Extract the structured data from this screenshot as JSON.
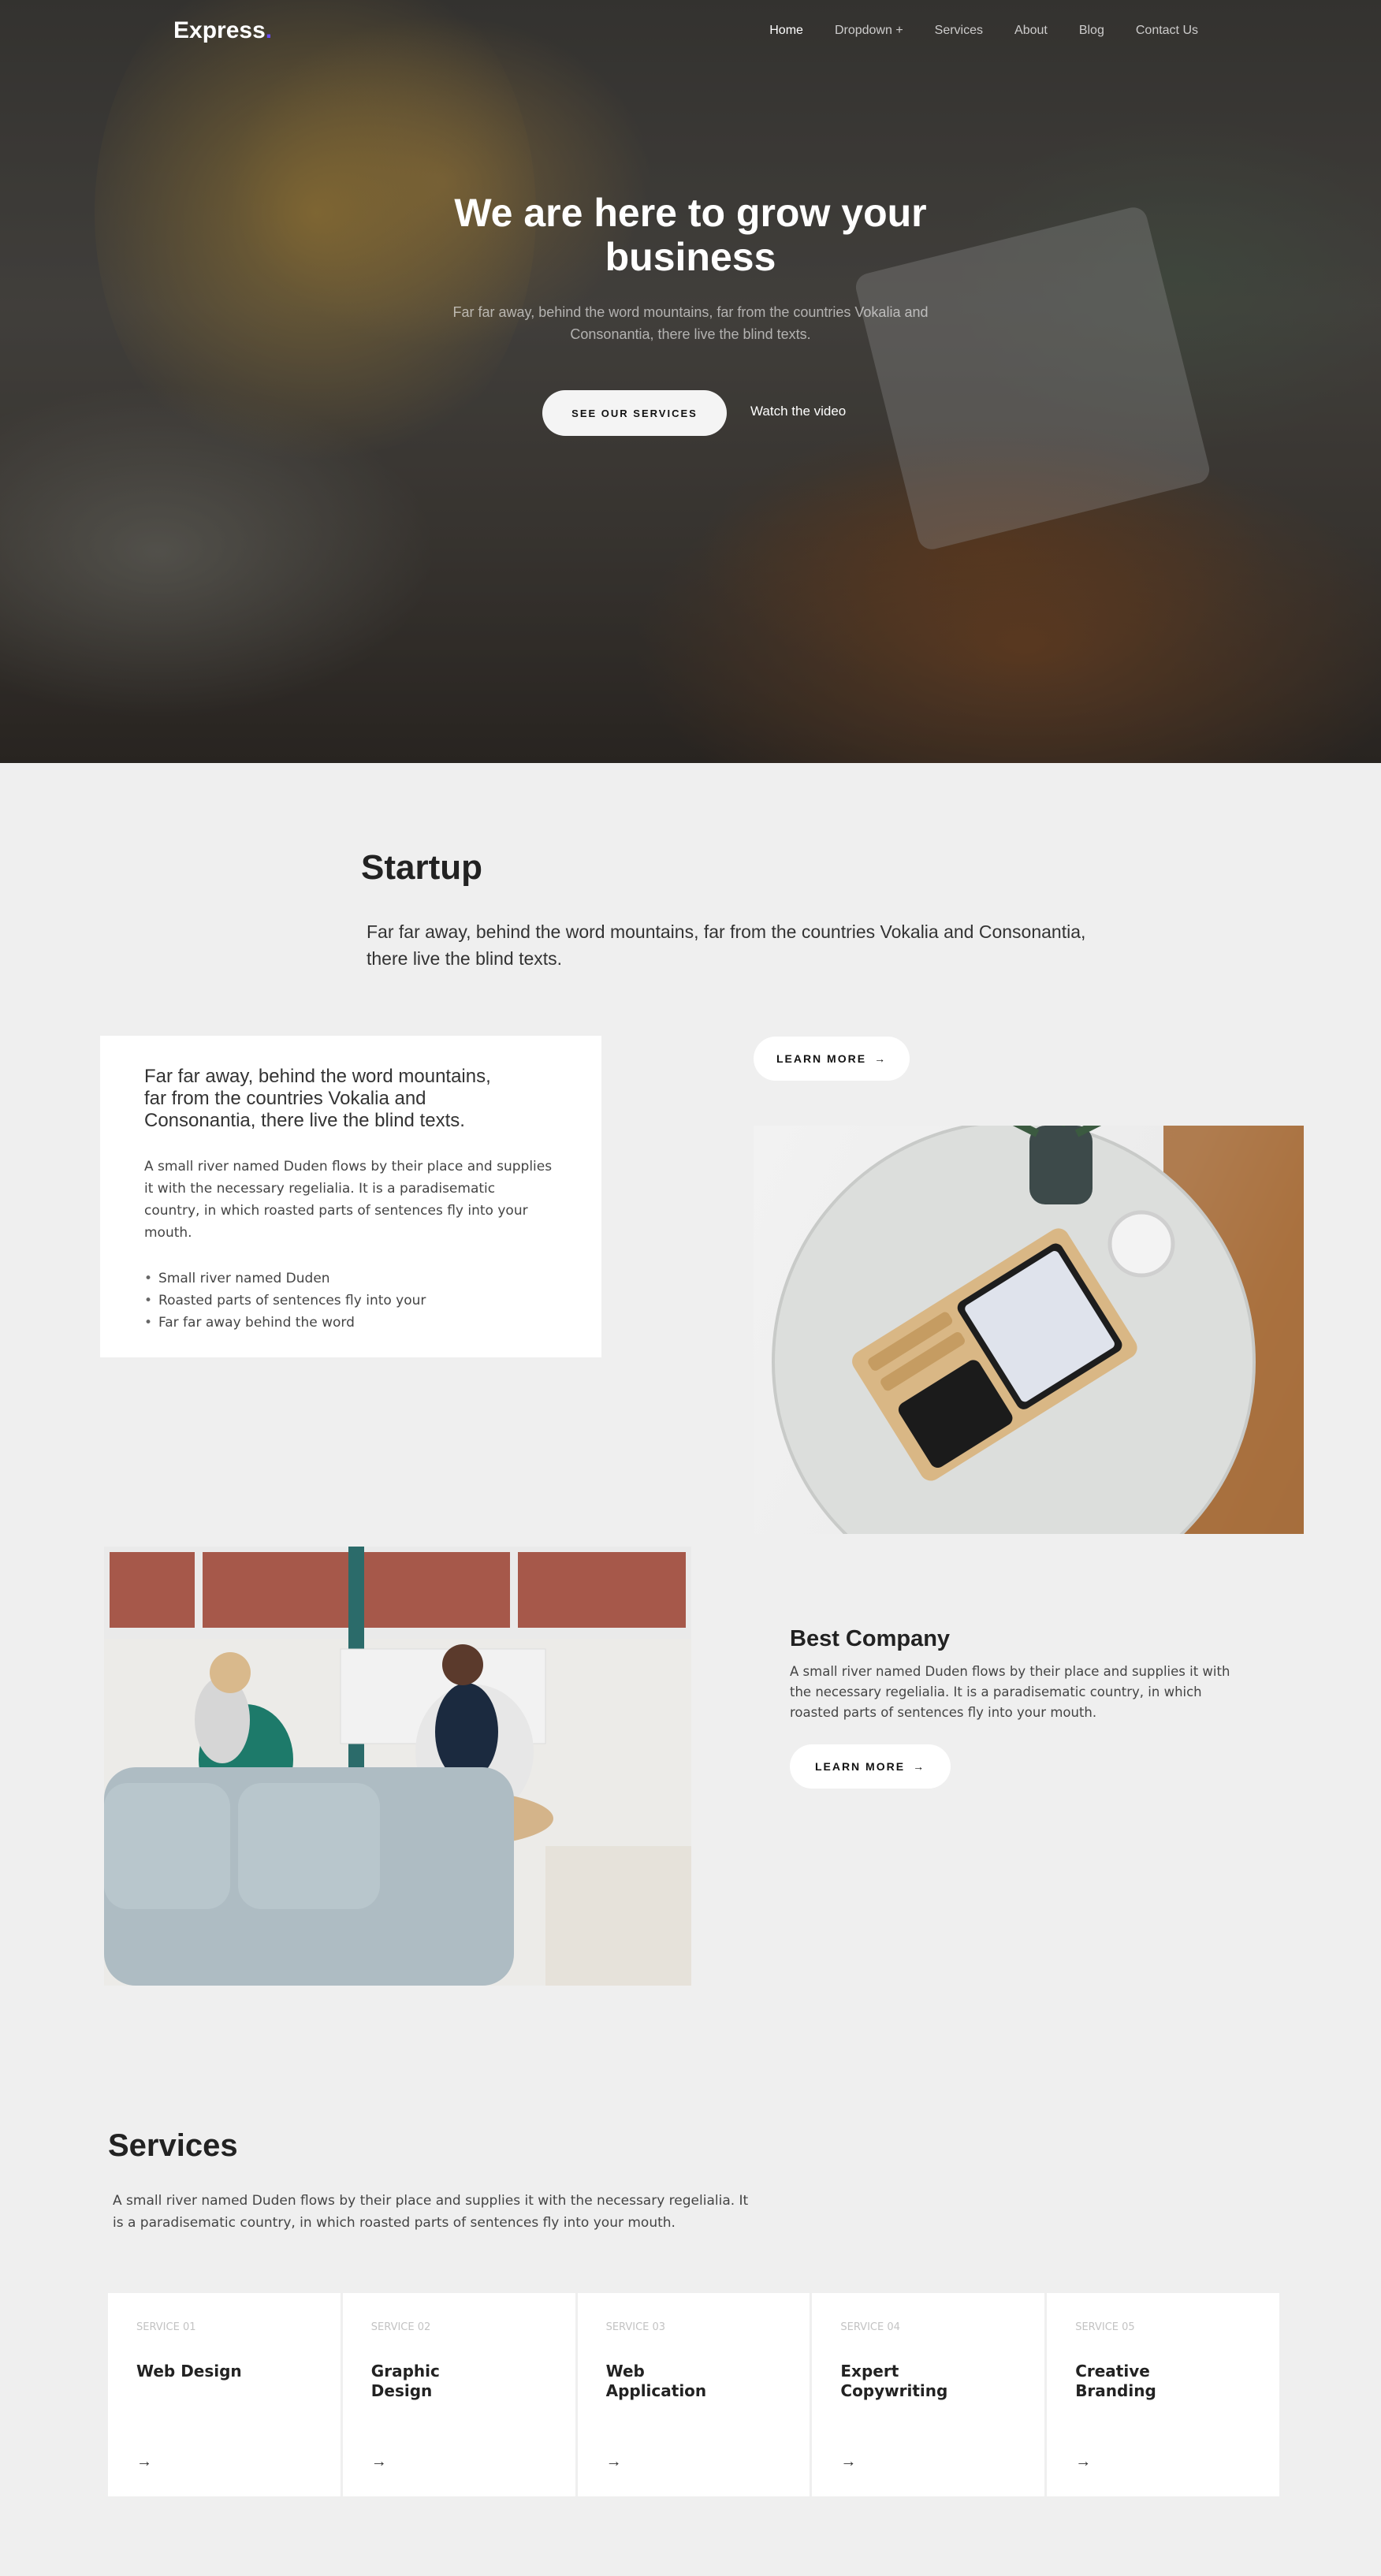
{
  "nav": {
    "brand": "Express",
    "brand_dot": ".",
    "links": [
      "Home",
      "Dropdown +",
      "Services",
      "About",
      "Blog",
      "Contact Us"
    ]
  },
  "hero": {
    "title": "We are here to grow your business",
    "subtitle": "Far far away, behind the word mountains, far from the countries Vokalia and Consonantia, there live the blind texts.",
    "cta_primary": "SEE OUR SERVICES",
    "cta_secondary": "Watch the video"
  },
  "startup": {
    "title": "Startup",
    "lead": "Far far away, behind the word mountains, far from the countries Vokalia and Consonantia, there live the blind texts.",
    "card": {
      "lead": "Far far away, behind the word mountains, far from the countries Vokalia and Consonantia, there live the blind texts.",
      "text": "A small river named Duden flows by their place and supplies it with the necessary regelialia. It is a paradisematic country, in which roasted parts of sentences fly into your mouth.",
      "list": [
        "Small river named Duden",
        "Roasted parts of sentences fly into your",
        "Far far away behind the word"
      ]
    },
    "learn_more": "LEARN MORE"
  },
  "best_company": {
    "title": "Best Company",
    "text": "A small river named Duden flows by their place and supplies it with the necessary regelialia. It is a paradisematic country, in which roasted parts of sentences fly into your mouth.",
    "learn_more": "LEARN MORE"
  },
  "services": {
    "title": "Services",
    "text": "A small river named Duden flows by their place and supplies it with the necessary regelialia. It is a paradisematic country, in which roasted parts of sentences fly into your mouth.",
    "items": [
      {
        "num": "SERVICE 01",
        "title": "Web Design"
      },
      {
        "num": "SERVICE 02",
        "title": "Graphic Design"
      },
      {
        "num": "SERVICE 03",
        "title": "Web Application"
      },
      {
        "num": "SERVICE 04",
        "title": "Expert Copywriting"
      },
      {
        "num": "SERVICE 05",
        "title": "Creative Branding"
      }
    ]
  },
  "icons": {
    "arrow": "arrow-right-icon"
  },
  "colors": {
    "accent": "#6a4cff",
    "page_bg": "#efefef",
    "card_bg": "#ffffff"
  }
}
